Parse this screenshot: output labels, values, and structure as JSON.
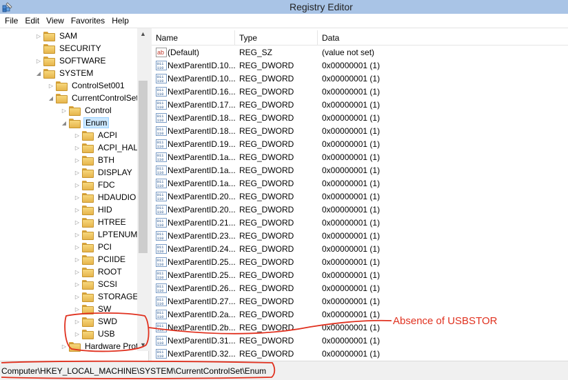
{
  "window": {
    "title": "Registry Editor"
  },
  "menu": [
    "File",
    "Edit",
    "View",
    "Favorites",
    "Help"
  ],
  "tree": [
    {
      "label": "SAM",
      "arrow": "▷",
      "level": 0,
      "selected": false
    },
    {
      "label": "SECURITY",
      "arrow": "",
      "level": 0,
      "selected": false
    },
    {
      "label": "SOFTWARE",
      "arrow": "▷",
      "level": 0,
      "selected": false
    },
    {
      "label": "SYSTEM",
      "arrow": "◢",
      "level": 0,
      "selected": false
    },
    {
      "label": "ControlSet001",
      "arrow": "▷",
      "level": 1,
      "selected": false
    },
    {
      "label": "CurrentControlSet",
      "arrow": "◢",
      "level": 1,
      "selected": false
    },
    {
      "label": "Control",
      "arrow": "▷",
      "level": 2,
      "selected": false
    },
    {
      "label": "Enum",
      "arrow": "◢",
      "level": 2,
      "selected": true
    },
    {
      "label": "ACPI",
      "arrow": "▷",
      "level": 3,
      "selected": false
    },
    {
      "label": "ACPI_HAL",
      "arrow": "▷",
      "level": 3,
      "selected": false
    },
    {
      "label": "BTH",
      "arrow": "▷",
      "level": 3,
      "selected": false
    },
    {
      "label": "DISPLAY",
      "arrow": "▷",
      "level": 3,
      "selected": false
    },
    {
      "label": "FDC",
      "arrow": "▷",
      "level": 3,
      "selected": false
    },
    {
      "label": "HDAUDIO",
      "arrow": "▷",
      "level": 3,
      "selected": false
    },
    {
      "label": "HID",
      "arrow": "▷",
      "level": 3,
      "selected": false
    },
    {
      "label": "HTREE",
      "arrow": "▷",
      "level": 3,
      "selected": false
    },
    {
      "label": "LPTENUM",
      "arrow": "▷",
      "level": 3,
      "selected": false
    },
    {
      "label": "PCI",
      "arrow": "▷",
      "level": 3,
      "selected": false
    },
    {
      "label": "PCIIDE",
      "arrow": "▷",
      "level": 3,
      "selected": false
    },
    {
      "label": "ROOT",
      "arrow": "▷",
      "level": 3,
      "selected": false
    },
    {
      "label": "SCSI",
      "arrow": "▷",
      "level": 3,
      "selected": false
    },
    {
      "label": "STORAGE",
      "arrow": "▷",
      "level": 3,
      "selected": false
    },
    {
      "label": "SW",
      "arrow": "▷",
      "level": 3,
      "selected": false
    },
    {
      "label": "SWD",
      "arrow": "▷",
      "level": 3,
      "selected": false
    },
    {
      "label": "USB",
      "arrow": "▷",
      "level": 3,
      "selected": false
    },
    {
      "label": "Hardware Prof",
      "arrow": "▷",
      "level": 2,
      "selected": false
    }
  ],
  "columns": {
    "name": "Name",
    "type": "Type",
    "data": "Data"
  },
  "values": [
    {
      "name": "(Default)",
      "type": "REG_SZ",
      "data": "(value not set)",
      "icon": "string-value-icon"
    },
    {
      "name": "NextParentID.10...",
      "type": "REG_DWORD",
      "data": "0x00000001 (1)",
      "icon": "binary-value-icon"
    },
    {
      "name": "NextParentID.10...",
      "type": "REG_DWORD",
      "data": "0x00000001 (1)",
      "icon": "binary-value-icon"
    },
    {
      "name": "NextParentID.16...",
      "type": "REG_DWORD",
      "data": "0x00000001 (1)",
      "icon": "binary-value-icon"
    },
    {
      "name": "NextParentID.17...",
      "type": "REG_DWORD",
      "data": "0x00000001 (1)",
      "icon": "binary-value-icon"
    },
    {
      "name": "NextParentID.18...",
      "type": "REG_DWORD",
      "data": "0x00000001 (1)",
      "icon": "binary-value-icon"
    },
    {
      "name": "NextParentID.18...",
      "type": "REG_DWORD",
      "data": "0x00000001 (1)",
      "icon": "binary-value-icon"
    },
    {
      "name": "NextParentID.19...",
      "type": "REG_DWORD",
      "data": "0x00000001 (1)",
      "icon": "binary-value-icon"
    },
    {
      "name": "NextParentID.1a...",
      "type": "REG_DWORD",
      "data": "0x00000001 (1)",
      "icon": "binary-value-icon"
    },
    {
      "name": "NextParentID.1a...",
      "type": "REG_DWORD",
      "data": "0x00000001 (1)",
      "icon": "binary-value-icon"
    },
    {
      "name": "NextParentID.1a...",
      "type": "REG_DWORD",
      "data": "0x00000001 (1)",
      "icon": "binary-value-icon"
    },
    {
      "name": "NextParentID.20...",
      "type": "REG_DWORD",
      "data": "0x00000001 (1)",
      "icon": "binary-value-icon"
    },
    {
      "name": "NextParentID.20...",
      "type": "REG_DWORD",
      "data": "0x00000001 (1)",
      "icon": "binary-value-icon"
    },
    {
      "name": "NextParentID.21...",
      "type": "REG_DWORD",
      "data": "0x00000001 (1)",
      "icon": "binary-value-icon"
    },
    {
      "name": "NextParentID.23...",
      "type": "REG_DWORD",
      "data": "0x00000001 (1)",
      "icon": "binary-value-icon"
    },
    {
      "name": "NextParentID.24...",
      "type": "REG_DWORD",
      "data": "0x00000001 (1)",
      "icon": "binary-value-icon"
    },
    {
      "name": "NextParentID.25...",
      "type": "REG_DWORD",
      "data": "0x00000001 (1)",
      "icon": "binary-value-icon"
    },
    {
      "name": "NextParentID.25...",
      "type": "REG_DWORD",
      "data": "0x00000001 (1)",
      "icon": "binary-value-icon"
    },
    {
      "name": "NextParentID.26...",
      "type": "REG_DWORD",
      "data": "0x00000001 (1)",
      "icon": "binary-value-icon"
    },
    {
      "name": "NextParentID.27...",
      "type": "REG_DWORD",
      "data": "0x00000001 (1)",
      "icon": "binary-value-icon"
    },
    {
      "name": "NextParentID.2a...",
      "type": "REG_DWORD",
      "data": "0x00000001 (1)",
      "icon": "binary-value-icon"
    },
    {
      "name": "NextParentID.2b...",
      "type": "REG_DWORD",
      "data": "0x00000001 (1)",
      "icon": "binary-value-icon"
    },
    {
      "name": "NextParentID.31...",
      "type": "REG_DWORD",
      "data": "0x00000001 (1)",
      "icon": "binary-value-icon"
    },
    {
      "name": "NextParentID.32...",
      "type": "REG_DWORD",
      "data": "0x00000001 (1)",
      "icon": "binary-value-icon"
    }
  ],
  "status": {
    "path": "Computer\\HKEY_LOCAL_MACHINE\\SYSTEM\\CurrentControlSet\\Enum"
  },
  "annotation": {
    "text": "Absence of USBSTOR",
    "color": "#e0301e"
  },
  "colors": {
    "titlebar": "#a9c4e6",
    "selection": "#cce8ff"
  }
}
